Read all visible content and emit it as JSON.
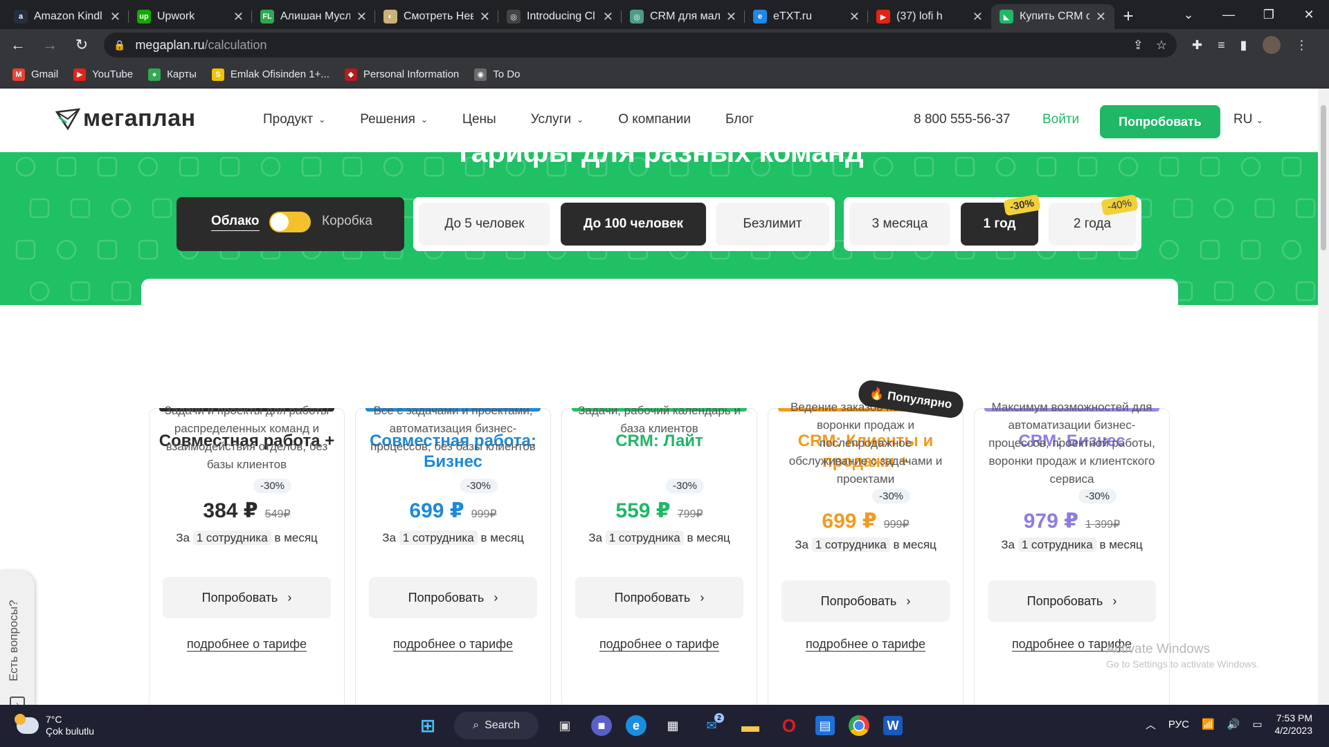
{
  "browser": {
    "tabs": [
      {
        "title": "Amazon Kindl",
        "fav": "a",
        "favColor": "#232f3e"
      },
      {
        "title": "Upwork",
        "fav": "up",
        "favColor": "#14a800"
      },
      {
        "title": "Алишан Мусл",
        "fav": "FL",
        "favColor": "#2fa84f"
      },
      {
        "title": "Смотреть Нев",
        "fav": "◐",
        "favColor": "#c9b27a"
      },
      {
        "title": "Introducing Cl",
        "fav": "◎",
        "favColor": "#444"
      },
      {
        "title": "CRM для мало",
        "fav": "◎",
        "favColor": "#4c9c88"
      },
      {
        "title": "eTXT.ru",
        "fav": "e",
        "favColor": "#1e88e5"
      },
      {
        "title": "(37) lofi h",
        "fav": "▶",
        "favColor": "#e62117"
      },
      {
        "title": "Купить CRM с",
        "fav": "◣",
        "favColor": "#20b767"
      }
    ],
    "url_host": "megaplan.ru",
    "url_path": "/calculation",
    "bookmarks": [
      {
        "label": "Gmail",
        "icon": "M",
        "color": "#ea4335"
      },
      {
        "label": "YouTube",
        "icon": "▶",
        "color": "#e62117"
      },
      {
        "label": "Карты",
        "icon": "●",
        "color": "#34a853"
      },
      {
        "label": "Emlak Ofisinden 1+...",
        "icon": "S",
        "color": "#f2c200"
      },
      {
        "label": "Personal Information",
        "icon": "◆",
        "color": "#b71c1c"
      },
      {
        "label": "To Do",
        "icon": "◉",
        "color": "#6b6b6b"
      }
    ]
  },
  "header": {
    "logo": "мегаплан",
    "nav": [
      {
        "label": "Продукт",
        "dropdown": true
      },
      {
        "label": "Решения",
        "dropdown": true
      },
      {
        "label": "Цены",
        "dropdown": false
      },
      {
        "label": "Услуги",
        "dropdown": true
      },
      {
        "label": "О компании",
        "dropdown": false
      },
      {
        "label": "Блог",
        "dropdown": false
      }
    ],
    "phone": "8 800 555-56-37",
    "login": "Войти",
    "try": "Попробовать",
    "lang": "RU"
  },
  "hero": {
    "title": "Тарифы для разных команд",
    "deploy": {
      "cloud": "Облако",
      "box": "Коробка"
    },
    "team_sizes": [
      "До 5 человек",
      "До 100 человек",
      "Безлимит"
    ],
    "selected_team": "До 100 человек",
    "periods": [
      {
        "label": "3 месяца",
        "discount": ""
      },
      {
        "label": "1 год",
        "discount": "-30%"
      },
      {
        "label": "2 года",
        "discount": "-40%"
      }
    ],
    "selected_period": "1 год"
  },
  "popular_badge": "🔥 Популярно",
  "plans": [
    {
      "name": "Совместная работа +",
      "color": "#2b2b2b",
      "line": "#2b2b2b",
      "desc": "Задачи и проекты для работы распределенных команд и взаимодействия отделов, без базы клиентов",
      "price": "384 ₽",
      "old": "549₽",
      "discount": "-30%",
      "per_prefix": "За",
      "per_emp": "1 сотрудника",
      "per_suffix": "в месяц",
      "try": "Попробовать",
      "more": "подробнее о тарифе"
    },
    {
      "name": "Совместная работа: Бизнес",
      "color": "#1c8ad8",
      "line": "#1c8ad8",
      "desc": "Все с задачами и проектами, автоматизация бизнес-процессов, без базы клиентов",
      "price": "699 ₽",
      "old": "999₽",
      "discount": "-30%",
      "per_prefix": "За",
      "per_emp": "1 сотрудника",
      "per_suffix": "в месяц",
      "try": "Попробовать",
      "more": "подробнее о тарифе"
    },
    {
      "name": "CRM: Лайт",
      "color": "#20b767",
      "line": "#20c064",
      "desc": "Задачи, рабочий календарь и база клиентов",
      "price": "559 ₽",
      "old": "799₽",
      "discount": "-30%",
      "per_prefix": "За",
      "per_emp": "1 сотрудника",
      "per_suffix": "в месяц",
      "try": "Попробовать",
      "more": "подробнее о тарифе"
    },
    {
      "name": "CRM: Клиенты и продажи +",
      "color": "#f39a1e",
      "line": "#f39a1e",
      "desc": "Ведение заказов по этапам воронки продаж и послепродажное обслуживание с задачами и проектами",
      "price": "699 ₽",
      "old": "999₽",
      "discount": "-30%",
      "per_prefix": "За",
      "per_emp": "1 сотрудника",
      "per_suffix": "в месяц",
      "try": "Попробовать",
      "more": "подробнее о тарифе"
    },
    {
      "name": "CRM: Бизнес",
      "color": "#8f7be0",
      "line": "#9b86e8",
      "desc": "Максимум возможностей для автоматизации бизнес-процессов, проектной работы, воронки продаж и клиентского сервиса",
      "price": "979 ₽",
      "old": "1 399₽",
      "discount": "-30%",
      "per_prefix": "За",
      "per_emp": "1 сотрудника",
      "per_suffix": "в месяц",
      "try": "Попробовать",
      "more": "подробнее о тарифе"
    }
  ],
  "side_help": "Есть вопросы?",
  "watermark": {
    "line1": "Activate Windows",
    "line2": "Go to Settings to activate Windows."
  },
  "taskbar": {
    "temp": "7°C",
    "weather": "Çok bulutlu",
    "search": "Search",
    "lang": "РУС",
    "time": "7:53 PM",
    "date": "4/2/2023",
    "mail_badge": "2"
  }
}
